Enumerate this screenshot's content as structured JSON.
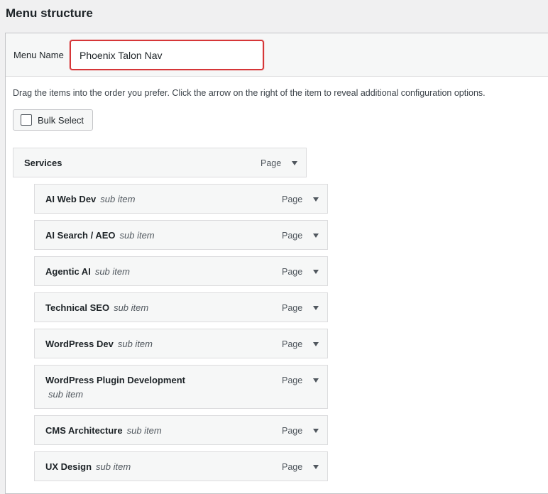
{
  "heading": "Menu structure",
  "menu_name": {
    "label": "Menu Name",
    "value": "Phoenix Talon Nav"
  },
  "instructions": "Drag the items into the order you prefer. Click the arrow on the right of the item to reveal additional configuration options.",
  "bulk_select": {
    "label": "Bulk Select",
    "checked": false
  },
  "items": [
    {
      "title": "Services",
      "sub": "",
      "type": "Page",
      "depth": 0
    },
    {
      "title": "AI Web Dev",
      "sub": "sub item",
      "type": "Page",
      "depth": 1
    },
    {
      "title": "AI Search / AEO",
      "sub": "sub item",
      "type": "Page",
      "depth": 1
    },
    {
      "title": "Agentic AI",
      "sub": "sub item",
      "type": "Page",
      "depth": 1
    },
    {
      "title": "Technical SEO",
      "sub": "sub item",
      "type": "Page",
      "depth": 1
    },
    {
      "title": "WordPress Dev",
      "sub": "sub item",
      "type": "Page",
      "depth": 1
    },
    {
      "title": "WordPress Plugin Development",
      "sub": "sub item",
      "type": "Page",
      "depth": 1
    },
    {
      "title": "CMS Architecture",
      "sub": "sub item",
      "type": "Page",
      "depth": 1
    },
    {
      "title": "UX Design",
      "sub": "sub item",
      "type": "Page",
      "depth": 1
    }
  ]
}
